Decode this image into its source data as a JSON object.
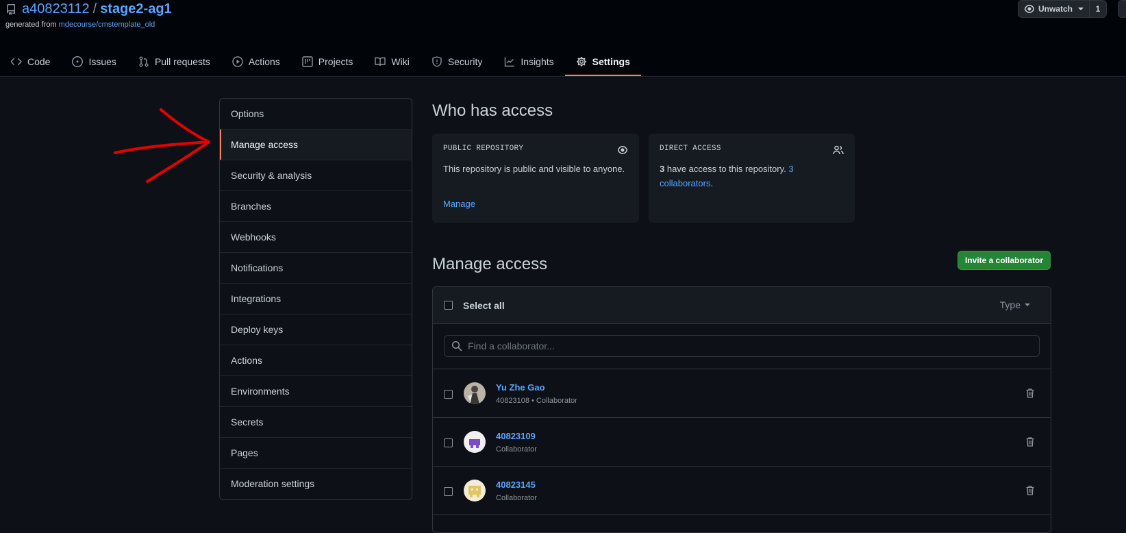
{
  "repo": {
    "owner": "a40823112",
    "separator": "/",
    "name": "stage2-ag1",
    "generated_prefix": "generated from",
    "template_link": "mdecourse/cmstemplate_old"
  },
  "watch": {
    "label": "Unwatch",
    "count": "1"
  },
  "tabs": [
    {
      "label": "Code",
      "icon": "code-icon"
    },
    {
      "label": "Issues",
      "icon": "issue-icon"
    },
    {
      "label": "Pull requests",
      "icon": "pull-request-icon"
    },
    {
      "label": "Actions",
      "icon": "play-icon"
    },
    {
      "label": "Projects",
      "icon": "project-icon"
    },
    {
      "label": "Wiki",
      "icon": "book-icon"
    },
    {
      "label": "Security",
      "icon": "shield-icon"
    },
    {
      "label": "Insights",
      "icon": "graph-icon"
    },
    {
      "label": "Settings",
      "icon": "gear-icon",
      "active": true
    }
  ],
  "sidebar": {
    "items": [
      {
        "label": "Options"
      },
      {
        "label": "Manage access",
        "selected": true
      },
      {
        "label": "Security & analysis"
      },
      {
        "label": "Branches"
      },
      {
        "label": "Webhooks"
      },
      {
        "label": "Notifications"
      },
      {
        "label": "Integrations"
      },
      {
        "label": "Deploy keys"
      },
      {
        "label": "Actions"
      },
      {
        "label": "Environments"
      },
      {
        "label": "Secrets"
      },
      {
        "label": "Pages"
      },
      {
        "label": "Moderation settings"
      }
    ]
  },
  "who_has_access": {
    "heading": "Who has access",
    "public_card": {
      "label": "PUBLIC REPOSITORY",
      "text": "This repository is public and visible to anyone.",
      "link": "Manage",
      "icon": "eye-icon"
    },
    "direct_card": {
      "label": "DIRECT ACCESS",
      "count": "3",
      "text_mid": "have access to this repository.",
      "link": "3 collaborators",
      "suffix": ".",
      "icon": "people-icon"
    }
  },
  "manage_access": {
    "heading": "Manage access",
    "invite_button": "Invite a collaborator",
    "select_all": "Select all",
    "type_filter": "Type",
    "search_placeholder": "Find a collaborator...",
    "collaborators": [
      {
        "name": "Yu Zhe Gao",
        "role": "40823108 • Collaborator",
        "avatar": "photo"
      },
      {
        "name": "40823109",
        "role": "Collaborator",
        "avatar": "purple-identicon"
      },
      {
        "name": "40823145",
        "role": "Collaborator",
        "avatar": "yellow-identicon"
      }
    ]
  },
  "colors": {
    "background": "#0d1117",
    "header_bg": "#010409",
    "link": "#58a6ff",
    "accent_underline": "#f78166",
    "primary_button": "#238636",
    "annotation_arrow": "#e50000"
  }
}
